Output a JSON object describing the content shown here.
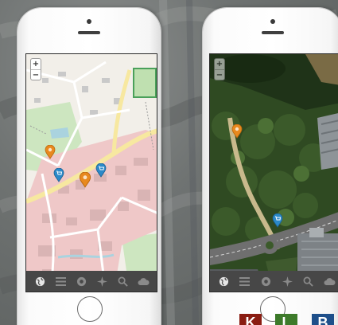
{
  "map_controls": {
    "zoom_in": "+",
    "zoom_out": "−"
  },
  "screens": [
    {
      "id": "left",
      "map_style": "street-map"
    },
    {
      "id": "right",
      "map_style": "satellite"
    }
  ],
  "markers": {
    "orange_color": "#e8891e",
    "blue_color": "#2b89c8",
    "blue_icon": "cart-icon"
  },
  "toolbar": {
    "icons": [
      "globe-icon",
      "list-icon",
      "record-icon",
      "crosshair-icon",
      "search-icon",
      "cloud-icon"
    ]
  },
  "badges": {
    "k": "K",
    "l": "L",
    "b": "B"
  },
  "colors": {
    "toolbar_bg": "#474747",
    "badge_k": "#8a1d12",
    "badge_l": "#3d7a2a",
    "badge_b": "#1e4f8a"
  }
}
